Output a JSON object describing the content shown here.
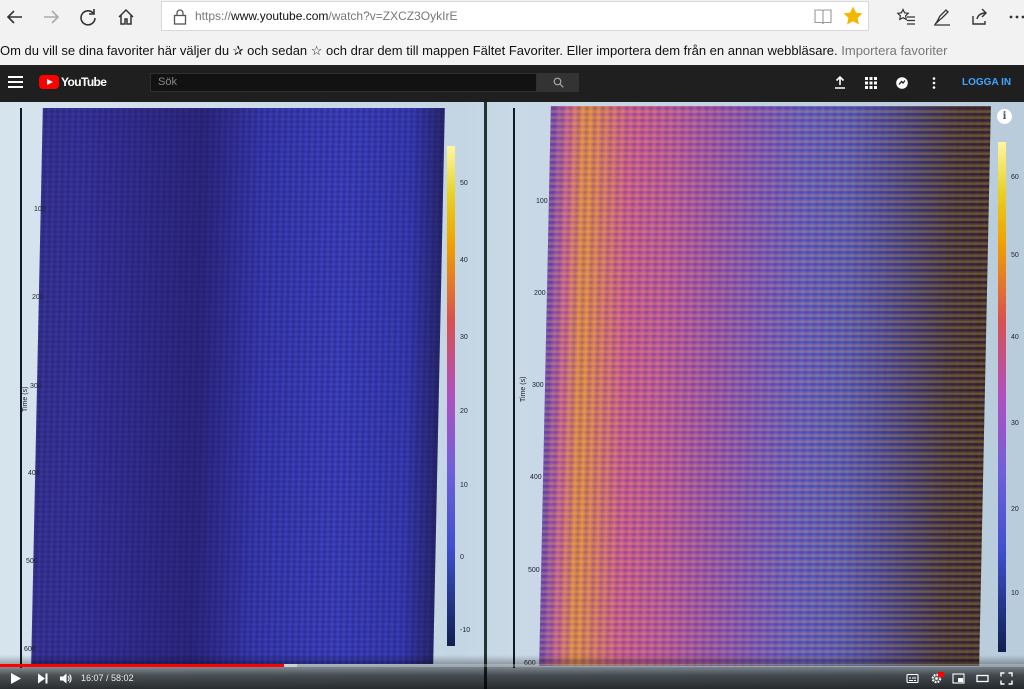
{
  "browser": {
    "url_prefix": "https://",
    "url_domain": "www.youtube.com",
    "url_path": "/watch?v=ZXCZ3OykIrE",
    "star_color": "#f2b800"
  },
  "favorites_bar": {
    "text": "Om du vill se dina favoriter här väljer du  ✰  och sedan ☆ och drar dem till mappen Fältet Favoriter. Eller importera dem från en annan webbläsare.",
    "import_link": "Importera favoriter"
  },
  "youtube": {
    "logo_text": "YouTube",
    "search_placeholder": "Sök",
    "login_label": "LOGGA IN",
    "accent": "#3ea6ff",
    "brand_red": "#ff0000"
  },
  "video": {
    "left_chart": {
      "y_ticks": [
        "100",
        "200",
        "300",
        "400",
        "500",
        "600"
      ],
      "y_label": "Time (s)",
      "colorbar_ticks": [
        "50",
        "40",
        "30",
        "20",
        "10",
        "0",
        "-10"
      ]
    },
    "right_chart": {
      "y_ticks": [
        "100",
        "200",
        "300",
        "400",
        "500",
        "600"
      ],
      "y_label": "Time (s)",
      "colorbar_ticks": [
        "60",
        "50",
        "40",
        "30",
        "20",
        "10"
      ]
    }
  },
  "player": {
    "current_time": "16:07",
    "duration": "58:02",
    "progress_fraction": 0.277,
    "buffer_fraction": 0.29
  }
}
